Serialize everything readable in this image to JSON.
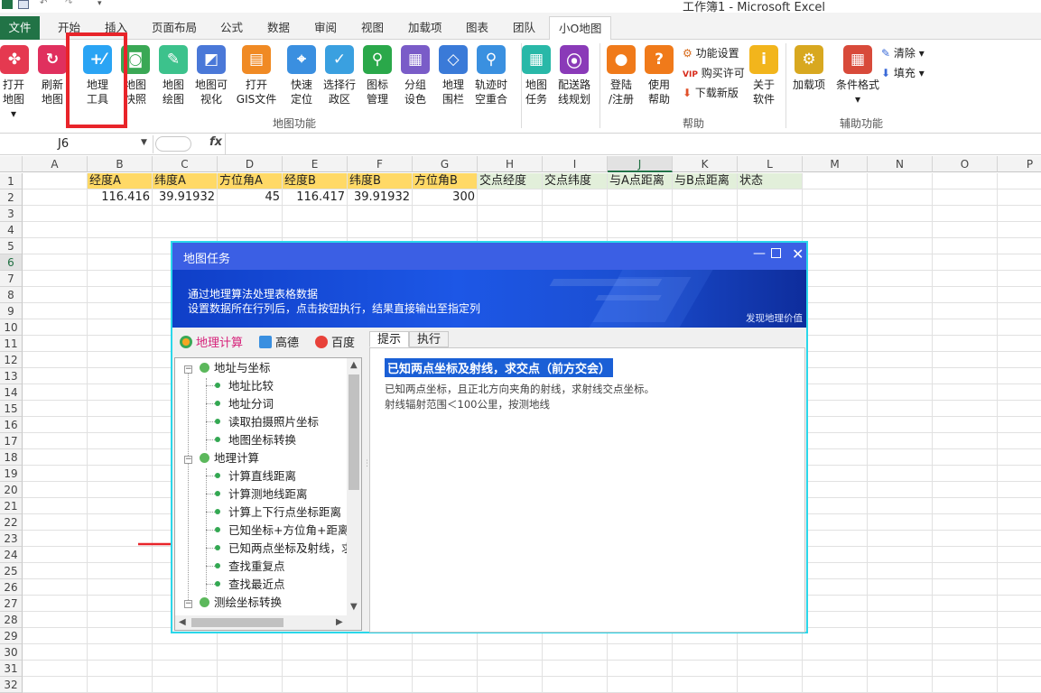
{
  "window": {
    "title": "工作簿1 - Microsoft Excel"
  },
  "tabs": [
    "文件",
    "开始",
    "插入",
    "页面布局",
    "公式",
    "数据",
    "审阅",
    "视图",
    "加载项",
    "图表",
    "团队",
    "小O地图"
  ],
  "ribbon": {
    "buttons": [
      {
        "label": "打开\n地图 ▾",
        "icon": "clover-icon",
        "color": "#e53950"
      },
      {
        "label": "刷新\n地图",
        "icon": "refresh-icon",
        "color": "#e0305e"
      },
      {
        "label": "地理\n工具",
        "icon": "math-tool-icon",
        "color": "#2aa4f4"
      },
      {
        "label": "地图\n快照",
        "icon": "camera-icon",
        "color": "#3aa855"
      },
      {
        "label": "地图\n绘图",
        "icon": "pencil-icon",
        "color": "#3cc28c"
      },
      {
        "label": "地图可\n视化",
        "icon": "chart-icon",
        "color": "#4a78d8"
      },
      {
        "label": "打开\nGIS文件",
        "icon": "gis-file-icon",
        "color": "#f08a24"
      },
      {
        "label": "快速\n定位",
        "icon": "crosshair-icon",
        "color": "#3a8fe0"
      },
      {
        "label": "选择行\n政区",
        "icon": "select-region-icon",
        "color": "#3aa0e0"
      },
      {
        "label": "图标\n管理",
        "icon": "pin-manage-icon",
        "color": "#2aa84a"
      },
      {
        "label": "分组\n设色",
        "icon": "grid-color-icon",
        "color": "#7a5cc8"
      },
      {
        "label": "地理\n围栏",
        "icon": "fence-icon",
        "color": "#3a7ad8"
      },
      {
        "label": "轨迹时\n空重合",
        "icon": "track-pin-icon",
        "color": "#3a90e0"
      },
      {
        "label": "地图\n任务",
        "icon": "calendar-icon",
        "color": "#29b8a8"
      },
      {
        "label": "配送路\n线规划",
        "icon": "route-icon",
        "color": "#8a3ab8"
      },
      {
        "label": "登陆\n/注册",
        "icon": "user-icon",
        "color": "#f07a1a"
      },
      {
        "label": "使用\n帮助",
        "icon": "help-icon",
        "color": "#f07a1a"
      },
      {
        "label": "关于\n软件",
        "icon": "info-icon",
        "color": "#f2b51c"
      },
      {
        "label": "加载项",
        "icon": "gears-icon",
        "color": "#d8a820"
      },
      {
        "label": "条件格式\n▾",
        "icon": "cond-format-icon",
        "color": "#d84a3a"
      }
    ],
    "small_items": {
      "settings": "功能设置",
      "license": "购买许可",
      "download": "下载新版",
      "clear": "清除 ▾",
      "fill": "填充 ▾"
    },
    "groups": {
      "map_functions": "地图功能",
      "help": "帮助",
      "aux": "辅助功能"
    }
  },
  "formula_bar": {
    "name_box": "J6",
    "fx": "fx",
    "value": ""
  },
  "sheet": {
    "columns": [
      "A",
      "B",
      "C",
      "D",
      "E",
      "F",
      "G",
      "H",
      "I",
      "J",
      "K",
      "L",
      "M",
      "N",
      "O",
      "P"
    ],
    "rows": [
      "1",
      "2",
      "3",
      "4",
      "5",
      "6",
      "7",
      "8",
      "9",
      "10",
      "11",
      "12",
      "13",
      "14",
      "15",
      "16",
      "17",
      "18",
      "19",
      "20",
      "21",
      "22",
      "23",
      "24",
      "25",
      "26",
      "27",
      "28",
      "29",
      "30",
      "31",
      "32"
    ],
    "row1": [
      "经度A",
      "纬度A",
      "方位角A",
      "经度B",
      "纬度B",
      "方位角B",
      "交点经度",
      "交点纬度",
      "与A点距离",
      "与B点距离",
      "状态"
    ],
    "row2": [
      "116.416",
      "39.91932",
      "45",
      "116.417",
      "39.91932",
      "300"
    ]
  },
  "dialog": {
    "title": "地图任务",
    "banner_line1": "通过地理算法处理表格数据",
    "banner_line2": "设置数据所在行列后，点击按钮执行，结果直接输出至指定列",
    "banner_slogan": "发现地理价值",
    "sources": [
      "地理计算",
      "高德",
      "百度"
    ],
    "tree": [
      {
        "label": "地址与坐标",
        "level": 0
      },
      {
        "label": "地址比较",
        "level": 1
      },
      {
        "label": "地址分词",
        "level": 1
      },
      {
        "label": "读取拍摄照片坐标",
        "level": 1
      },
      {
        "label": "地图坐标转换",
        "level": 1
      },
      {
        "label": "地理计算",
        "level": 0
      },
      {
        "label": "计算直线距离",
        "level": 1
      },
      {
        "label": "计算测地线距离",
        "level": 1
      },
      {
        "label": "计算上下行点坐标距离",
        "level": 1
      },
      {
        "label": "已知坐标+方位角+距离，",
        "level": 1
      },
      {
        "label": "已知两点坐标及射线，求",
        "level": 1
      },
      {
        "label": "查找重复点",
        "level": 1
      },
      {
        "label": "查找最近点",
        "level": 1
      },
      {
        "label": "测绘坐标转换",
        "level": 0
      }
    ],
    "right_tabs": [
      "提示",
      "执行"
    ],
    "heading": "已知两点坐标及射线，求交点（前方交会）",
    "desc1": "已知两点坐标，且正北方向夹角的射线，求射线交点坐标。",
    "desc2": "射线辐射范围＜100公里，按测地线"
  }
}
